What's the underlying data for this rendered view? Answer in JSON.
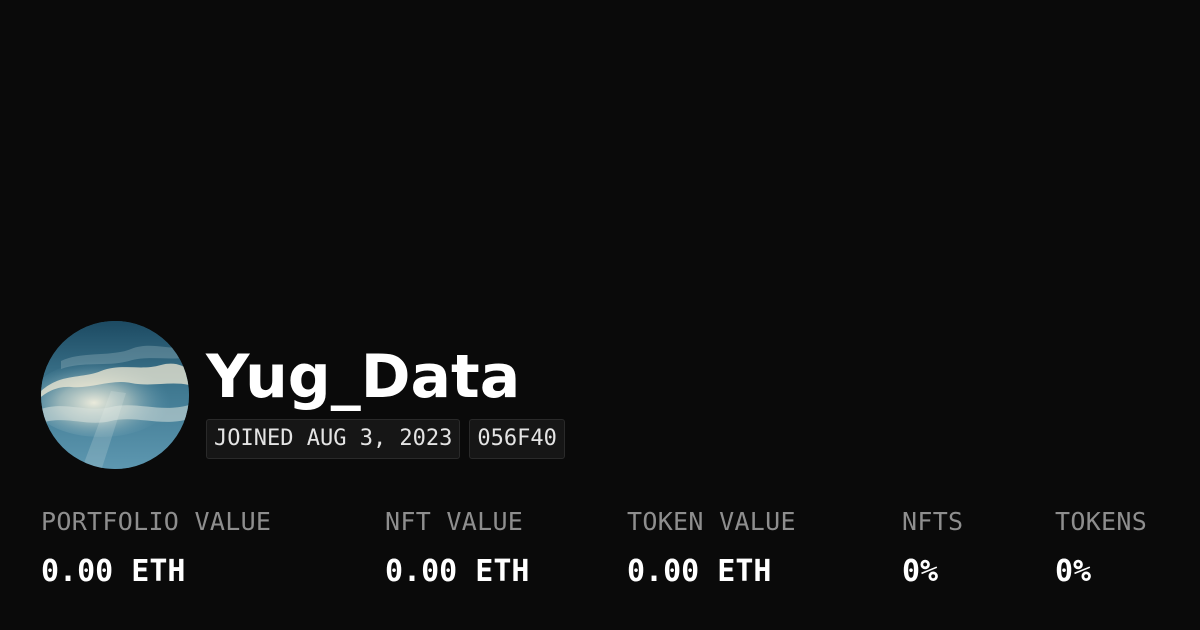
{
  "profile": {
    "username": "Yug_Data",
    "joined": "JOINED AUG 3, 2023",
    "address_short": "056F40"
  },
  "stats": [
    {
      "label": "PORTFOLIO VALUE",
      "value": "0.00 ETH"
    },
    {
      "label": "NFT VALUE",
      "value": "0.00 ETH"
    },
    {
      "label": "TOKEN VALUE",
      "value": "0.00 ETH"
    },
    {
      "label": "NFTS",
      "value": "0%"
    },
    {
      "label": "TOKENS",
      "value": "0%"
    }
  ],
  "colors": {
    "background": "#0a0a0a",
    "text_primary": "#ffffff",
    "text_muted": "#8e8e8e",
    "badge_bg": "#161616"
  }
}
